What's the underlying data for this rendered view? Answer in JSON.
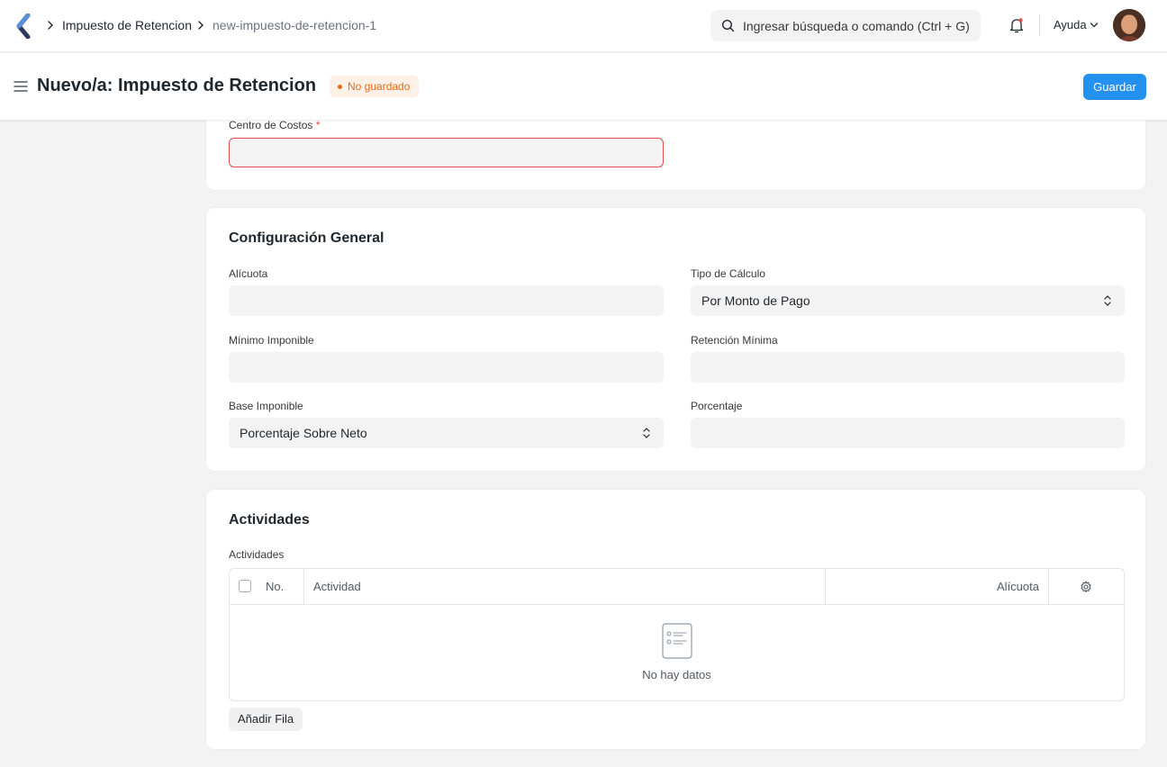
{
  "navbar": {
    "breadcrumbs": [
      "Impuesto de Retencion",
      "new-impuesto-de-retencion-1"
    ],
    "search_placeholder": "Ingresar búsqueda o comando (Ctrl + G)",
    "help_label": "Ayuda"
  },
  "page": {
    "title": "Nuevo/a: Impuesto de Retencion",
    "status_badge": "No guardado",
    "save_label": "Guardar"
  },
  "cost_center": {
    "label": "Centro de Costos",
    "required_mark": "*",
    "value": ""
  },
  "general": {
    "title": "Configuración General",
    "fields": {
      "alicuota": {
        "label": "Alícuota",
        "value": ""
      },
      "tipo_calculo": {
        "label": "Tipo de Cálculo",
        "value": "Por Monto de Pago"
      },
      "minimo_imponible": {
        "label": "Mínimo Imponible",
        "value": ""
      },
      "retencion_minima": {
        "label": "Retención Mínima",
        "value": ""
      },
      "base_imponible": {
        "label": "Base Imponible",
        "value": "Porcentaje Sobre Neto"
      },
      "porcentaje": {
        "label": "Porcentaje",
        "value": ""
      }
    }
  },
  "activities": {
    "title": "Actividades",
    "table_label": "Actividades",
    "columns": [
      "No.",
      "Actividad",
      "Alícuota"
    ],
    "empty_text": "No hay datos",
    "add_row_label": "Añadir Fila"
  },
  "colors": {
    "primary": "#2490ef",
    "error": "#e24c4c",
    "warning": "#e86c13"
  }
}
